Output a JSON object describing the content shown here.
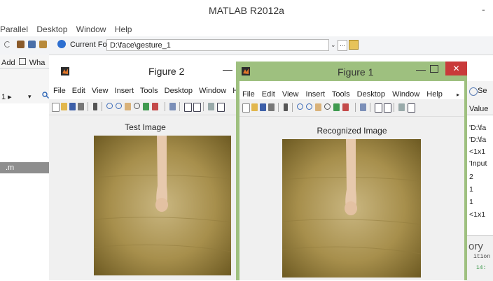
{
  "app": {
    "title": "MATLAB R2012a",
    "title_dash": "-"
  },
  "main_menu": [
    "Parallel",
    "Desktop",
    "Window",
    "Help"
  ],
  "toolbar": {
    "folder_label": "Current Folder:",
    "folder_value": "D:\\face\\gesture_1",
    "folder_dropdown": "⌄",
    "folder_browse": "...",
    "icons": [
      "redo-icon",
      "cut-icon",
      "copy-icon",
      "paste-icon",
      "help-icon",
      "folder-up-icon"
    ]
  },
  "left_panel": {
    "add_label": "Add",
    "whats_new": "Wha",
    "nav_text": "1 ▸",
    "nav_dropdown": "▾",
    "search_icon": "search-icon",
    "highlight_text": ".m"
  },
  "figure2": {
    "title": "Figure 2",
    "min_btn": "—",
    "menu": [
      "File",
      "Edit",
      "View",
      "Insert",
      "Tools",
      "Desktop",
      "Window",
      "Help"
    ],
    "axes_title": "Test Image"
  },
  "figure1": {
    "title": "Figure 1",
    "min_btn": "—",
    "close_btn": "✕",
    "menu": [
      "File",
      "Edit",
      "View",
      "Insert",
      "Tools",
      "Desktop",
      "Window",
      "Help"
    ],
    "menu_arrow": "▸",
    "axes_title": "Recognized Image"
  },
  "workspace": {
    "header": "Se",
    "value_header": "Value",
    "values": [
      "'D:\\fa",
      "'D:\\fa",
      "<1x1",
      "'Input",
      "2",
      "1",
      "1",
      "<1x1"
    ],
    "bottom_title": "ory",
    "bottom_line1": "ition",
    "bottom_line2": "14:"
  },
  "colors": {
    "figure1_frame": "#9ec07f",
    "close_button": "#c93a3a",
    "highlight_bar": "#8e8e8e"
  }
}
